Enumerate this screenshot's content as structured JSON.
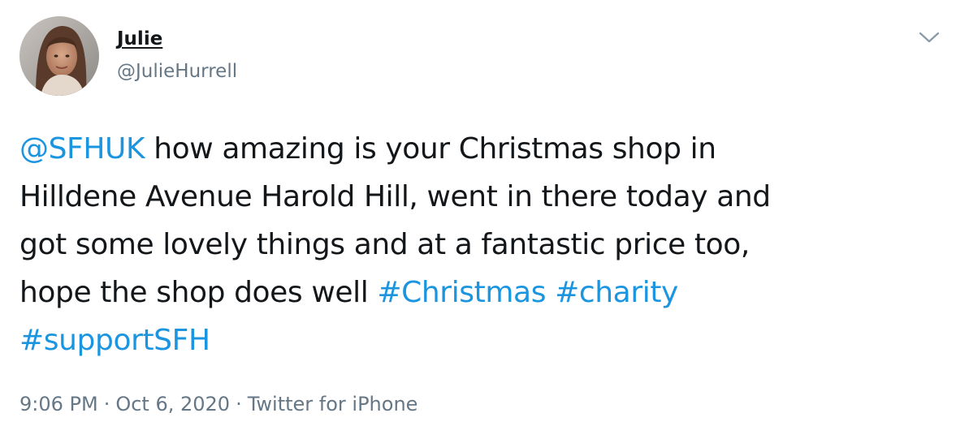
{
  "user": {
    "display_name": "Julie",
    "handle": "@JulieHurrell"
  },
  "tweet": {
    "lines": [
      [
        {
          "text": "@SFHUK",
          "kind": "mention"
        },
        {
          "text": " how amazing is your Christmas shop in",
          "kind": "text"
        }
      ],
      [
        {
          "text": "Hilldene Avenue Harold Hill, went in there today and",
          "kind": "text"
        }
      ],
      [
        {
          "text": "got some lovely things and at a fantastic price too,",
          "kind": "text"
        }
      ],
      [
        {
          "text": "hope the shop does well ",
          "kind": "text"
        },
        {
          "text": "#Christmas",
          "kind": "hashtag"
        },
        {
          "text": " ",
          "kind": "text"
        },
        {
          "text": "#charity",
          "kind": "hashtag"
        }
      ],
      [
        {
          "text": "#supportSFH",
          "kind": "hashtag"
        }
      ]
    ]
  },
  "meta": {
    "time": "9:06 PM",
    "separator": "·",
    "date": "Oct 6, 2020",
    "source": "Twitter for iPhone"
  },
  "icons": {
    "caret": "chevron-down-icon",
    "avatar": "profile-photo"
  },
  "colors": {
    "link": "#1b95e0",
    "secondary": "#657786",
    "primary": "#14171a"
  }
}
